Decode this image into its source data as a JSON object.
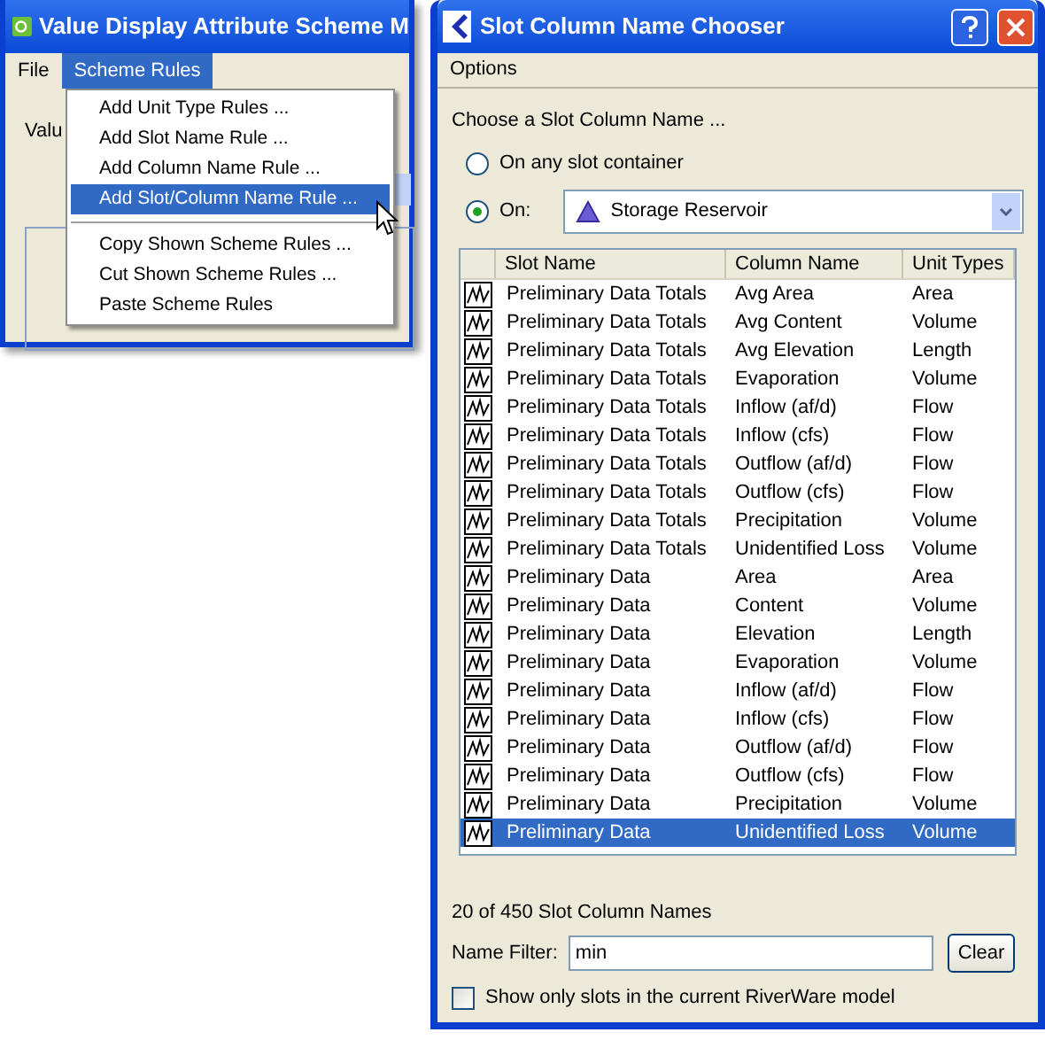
{
  "back_window": {
    "title": "Value Display Attribute Scheme M",
    "menus": [
      {
        "label": "File",
        "selected": false
      },
      {
        "label": "Scheme Rules",
        "selected": true
      }
    ],
    "partial_texts": [
      "Valu"
    ],
    "menu_items": [
      {
        "kind": "item",
        "label": "Add Unit Type Rules ...",
        "selected": false
      },
      {
        "kind": "item",
        "label": "Add Slot Name Rule ...",
        "selected": false
      },
      {
        "kind": "item",
        "label": "Add Column Name Rule ...",
        "selected": false
      },
      {
        "kind": "item",
        "label": "Add Slot/Column Name Rule ...",
        "selected": true
      },
      {
        "kind": "separator"
      },
      {
        "kind": "item",
        "label": "Copy Shown Scheme Rules ...",
        "selected": false
      },
      {
        "kind": "item",
        "label": "Cut Shown Scheme Rules ...",
        "selected": false
      },
      {
        "kind": "item",
        "label": "Paste Scheme Rules",
        "selected": false
      }
    ]
  },
  "dialog": {
    "title": "Slot Column Name Chooser",
    "menus": [
      "Options"
    ],
    "prompt": "Choose a Slot Column Name ...",
    "radios": [
      {
        "label": "On any slot container",
        "selected": false
      },
      {
        "label": "On:",
        "selected": true
      }
    ],
    "combo_value": "Storage Reservoir",
    "table": {
      "columns": [
        "Slot Name",
        "Column Name",
        "Unit Types"
      ],
      "rows": [
        {
          "slot_name": "Preliminary Data Totals",
          "column_name": "Avg Area",
          "unit_type": "Area",
          "selected": false
        },
        {
          "slot_name": "Preliminary Data Totals",
          "column_name": "Avg Content",
          "unit_type": "Volume",
          "selected": false
        },
        {
          "slot_name": "Preliminary Data Totals",
          "column_name": "Avg Elevation",
          "unit_type": "Length",
          "selected": false
        },
        {
          "slot_name": "Preliminary Data Totals",
          "column_name": "Evaporation",
          "unit_type": "Volume",
          "selected": false
        },
        {
          "slot_name": "Preliminary Data Totals",
          "column_name": "Inflow (af/d)",
          "unit_type": "Flow",
          "selected": false
        },
        {
          "slot_name": "Preliminary Data Totals",
          "column_name": "Inflow (cfs)",
          "unit_type": "Flow",
          "selected": false
        },
        {
          "slot_name": "Preliminary Data Totals",
          "column_name": "Outflow (af/d)",
          "unit_type": "Flow",
          "selected": false
        },
        {
          "slot_name": "Preliminary Data Totals",
          "column_name": "Outflow (cfs)",
          "unit_type": "Flow",
          "selected": false
        },
        {
          "slot_name": "Preliminary Data Totals",
          "column_name": "Precipitation",
          "unit_type": "Volume",
          "selected": false
        },
        {
          "slot_name": "Preliminary Data Totals",
          "column_name": "Unidentified Loss",
          "unit_type": "Volume",
          "selected": false
        },
        {
          "slot_name": "Preliminary Data",
          "column_name": "Area",
          "unit_type": "Area",
          "selected": false
        },
        {
          "slot_name": "Preliminary Data",
          "column_name": "Content",
          "unit_type": "Volume",
          "selected": false
        },
        {
          "slot_name": "Preliminary Data",
          "column_name": "Elevation",
          "unit_type": "Length",
          "selected": false
        },
        {
          "slot_name": "Preliminary Data",
          "column_name": "Evaporation",
          "unit_type": "Volume",
          "selected": false
        },
        {
          "slot_name": "Preliminary Data",
          "column_name": "Inflow (af/d)",
          "unit_type": "Flow",
          "selected": false
        },
        {
          "slot_name": "Preliminary Data",
          "column_name": "Inflow (cfs)",
          "unit_type": "Flow",
          "selected": false
        },
        {
          "slot_name": "Preliminary Data",
          "column_name": "Outflow (af/d)",
          "unit_type": "Flow",
          "selected": false
        },
        {
          "slot_name": "Preliminary Data",
          "column_name": "Outflow (cfs)",
          "unit_type": "Flow",
          "selected": false
        },
        {
          "slot_name": "Preliminary Data",
          "column_name": "Precipitation",
          "unit_type": "Volume",
          "selected": false
        },
        {
          "slot_name": "Preliminary Data",
          "column_name": "Unidentified Loss",
          "unit_type": "Volume",
          "selected": true
        }
      ]
    },
    "count_text": "20 of 450 Slot Column Names",
    "filter_label": "Name Filter:",
    "filter_value": "min",
    "clear_button": "Clear",
    "checkbox": {
      "label": "Show only slots in the current RiverWare model",
      "checked": false
    }
  }
}
